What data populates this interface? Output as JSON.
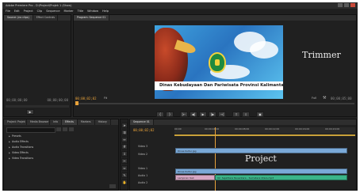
{
  "window": {
    "title": "Adobe Premiere Pro - D:\\Project\\Projek 1 (Show)"
  },
  "menu": [
    "File",
    "Edit",
    "Project",
    "Clip",
    "Sequence",
    "Marker",
    "Title",
    "Window",
    "Help"
  ],
  "source_panel": {
    "tabs": [
      "Source: (no clips)",
      "Effect Controls",
      "Audio Clip Mixer: Sequence 01"
    ],
    "timecode_left": "00;00;00;00",
    "timecode_right": "00;00;00;00"
  },
  "program_panel": {
    "tab": "Program: Sequence 01",
    "timecode": "00;00;02;02",
    "zoom": "Fit",
    "duration": "00;00;05;00",
    "resolution": "Full",
    "video_caption": "Dinas Kebudayaan Dan Pariwisata Provinsi Kalimantan"
  },
  "project_panel": {
    "tabs": [
      "Project: Projek 1",
      "Media Browser",
      "Info",
      "Effects",
      "Markers",
      "History"
    ],
    "effects": [
      "Presets",
      "Audio Effects",
      "Audio Transitions",
      "Video Effects",
      "Video Transitions"
    ]
  },
  "timeline": {
    "tab": "Sequence 01",
    "timecode": "00;00;02;02",
    "ruler": [
      "00;00",
      "00;00;04;00",
      "00;00;08;00",
      "00;00;12;00",
      "00;00;16;00",
      "00;00;20;00"
    ],
    "tracks": [
      {
        "name": "Video 3",
        "clip": "Dinas Kultur.jpg"
      },
      {
        "name": "Video 2",
        "clip": ""
      },
      {
        "name": "Video 1",
        "clip": ""
      },
      {
        "name": "Audio 1",
        "clip": "Dinas Kultur.jpg"
      },
      {
        "name": "Audio 2",
        "clip": "Lampiran Kali",
        "clip2": "02. Sejahtera Nusantara - Sumatera Utara.mp3"
      }
    ]
  },
  "overlay_labels": {
    "trimmer": "Trimmer",
    "project": "Project"
  },
  "colors": {
    "accent_timecode": "#e8a23a",
    "video_clip": "#7aa9d8",
    "audio_clip": "#3bb58a",
    "playhead": "#e8a23a"
  },
  "icons": [
    "play-icon",
    "step-back-icon",
    "step-forward-icon",
    "wrench-icon",
    "selection-tool-icon",
    "razor-tool-icon",
    "hand-tool-icon",
    "zoom-tool-icon"
  ]
}
